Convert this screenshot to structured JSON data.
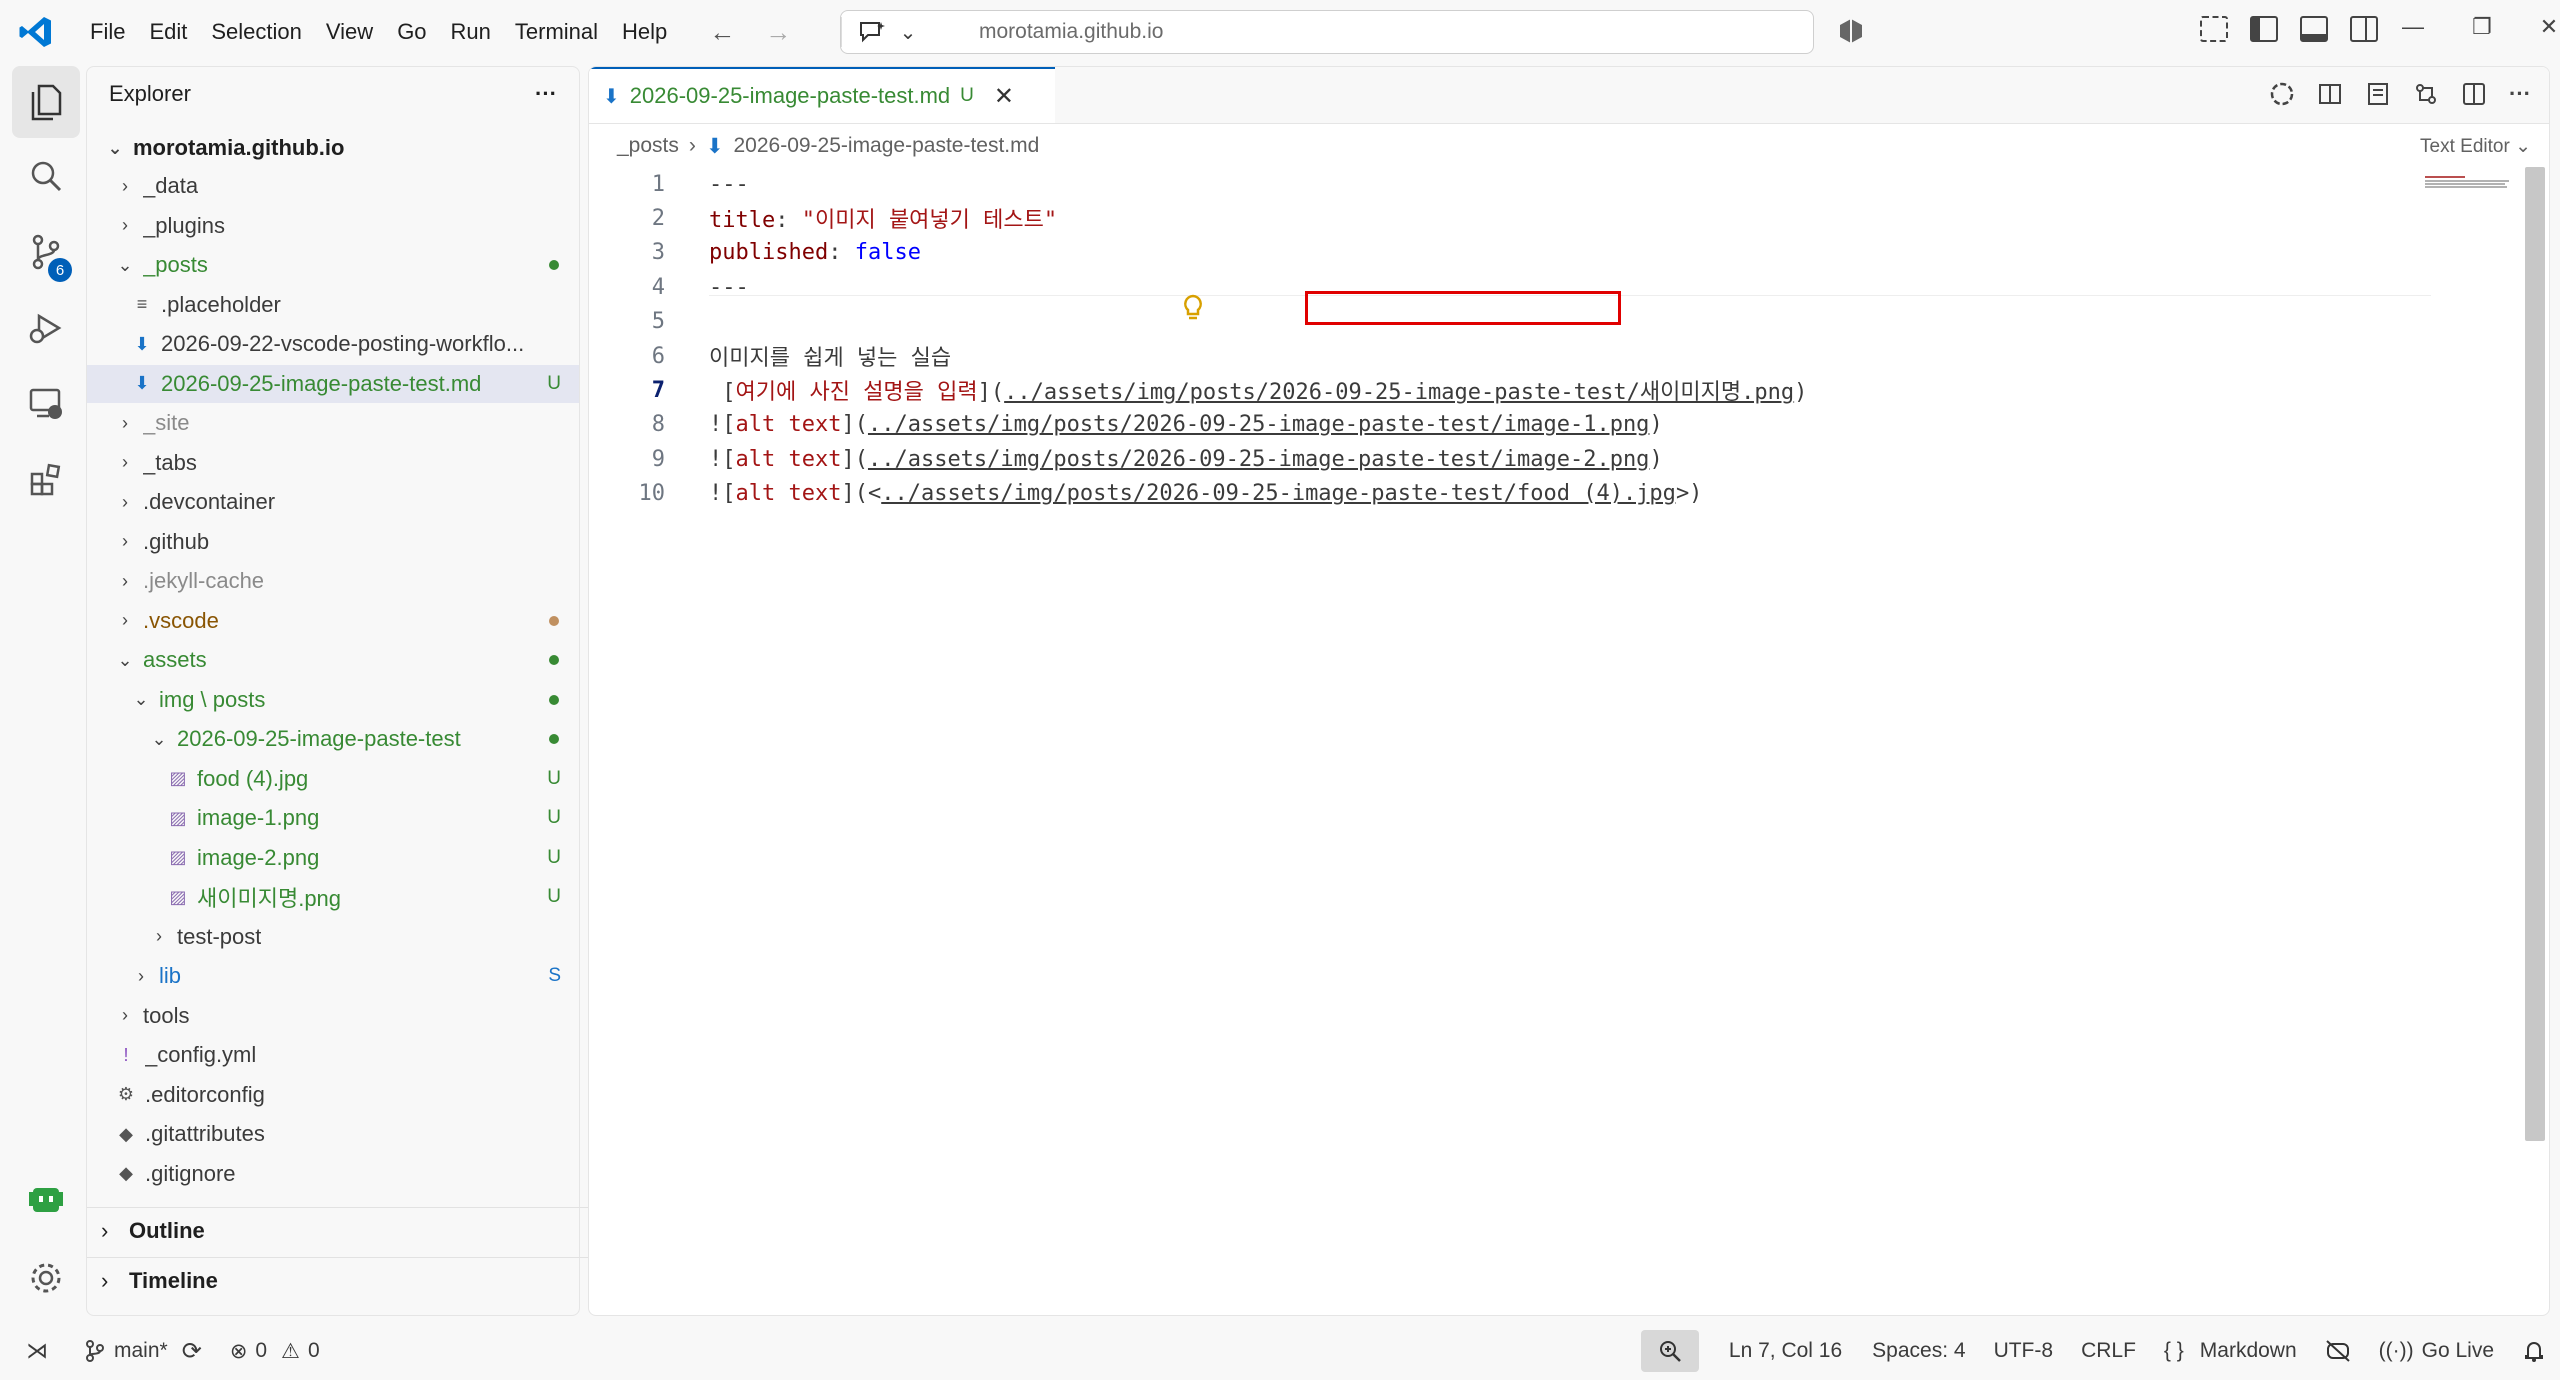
{
  "titlebar": {
    "menu": [
      "File",
      "Edit",
      "Selection",
      "View",
      "Go",
      "Run",
      "Terminal",
      "Help"
    ],
    "search_text": "morotamia.github.io"
  },
  "activity": {
    "source_control_badge": "6"
  },
  "sidebar": {
    "title": "Explorer",
    "more": "···",
    "root": "morotamia.github.io",
    "tree": [
      {
        "label": "_data",
        "chev": "›",
        "indent": 0,
        "color": "#3b3b3b"
      },
      {
        "label": "_plugins",
        "chev": "›",
        "indent": 0,
        "color": "#3b3b3b"
      },
      {
        "label": "_posts",
        "chev": "⌄",
        "indent": 0,
        "color": "#388a34",
        "dot": "#388a34"
      },
      {
        "label": ".placeholder",
        "icon": "≡",
        "indent": 1,
        "color": "#3b3b3b"
      },
      {
        "label": "2026-09-22-vscode-posting-workflo...",
        "icon": "⬇",
        "indent": 1,
        "color": "#3b3b3b"
      },
      {
        "label": "2026-09-25-image-paste-test.md",
        "icon": "⬇",
        "indent": 1,
        "color": "#388a34",
        "status": "U",
        "selected": true
      },
      {
        "label": "_site",
        "chev": "›",
        "indent": 0,
        "color": "#8a8a8a"
      },
      {
        "label": "_tabs",
        "chev": "›",
        "indent": 0,
        "color": "#3b3b3b"
      },
      {
        "label": ".devcontainer",
        "chev": "›",
        "indent": 0,
        "color": "#3b3b3b"
      },
      {
        "label": ".github",
        "chev": "›",
        "indent": 0,
        "color": "#3b3b3b"
      },
      {
        "label": ".jekyll-cache",
        "chev": "›",
        "indent": 0,
        "color": "#8a8a8a"
      },
      {
        "label": ".vscode",
        "chev": "›",
        "indent": 0,
        "color": "#895503",
        "dot": "#c09060"
      },
      {
        "label": "assets",
        "chev": "⌄",
        "indent": 0,
        "color": "#388a34",
        "dot": "#388a34"
      },
      {
        "label": "img \\ posts",
        "chev": "⌄",
        "indent": 1,
        "color": "#388a34",
        "dot": "#388a34"
      },
      {
        "label": "2026-09-25-image-paste-test",
        "chev": "⌄",
        "indent": 2,
        "color": "#388a34",
        "dot": "#388a34"
      },
      {
        "label": "food (4).jpg",
        "icon": "▨",
        "indent": 3,
        "color": "#388a34",
        "status": "U"
      },
      {
        "label": "image-1.png",
        "icon": "▨",
        "indent": 3,
        "color": "#388a34",
        "status": "U"
      },
      {
        "label": "image-2.png",
        "icon": "▨",
        "indent": 3,
        "color": "#388a34",
        "status": "U"
      },
      {
        "label": "새이미지명.png",
        "icon": "▨",
        "indent": 3,
        "color": "#388a34",
        "status": "U"
      },
      {
        "label": "test-post",
        "chev": "›",
        "indent": 2,
        "color": "#3b3b3b"
      },
      {
        "label": "lib",
        "chev": "›",
        "indent": 1,
        "color": "#1a73c7",
        "status": "S",
        "status_color": "#1a73c7"
      },
      {
        "label": "tools",
        "chev": "›",
        "indent": 0,
        "color": "#3b3b3b"
      },
      {
        "label": "_config.yml",
        "icon": "!",
        "indent": 0,
        "color": "#3b3b3b"
      },
      {
        "label": ".editorconfig",
        "icon": "⚙",
        "indent": 0,
        "color": "#3b3b3b"
      },
      {
        "label": ".gitattributes",
        "icon": "◆",
        "indent": 0,
        "color": "#3b3b3b"
      },
      {
        "label": ".gitignore",
        "icon": "◆",
        "indent": 0,
        "color": "#3b3b3b"
      }
    ],
    "outline": "Outline",
    "timeline": "Timeline"
  },
  "editor": {
    "tab_title": "2026-09-25-image-paste-test.md",
    "tab_status": "U",
    "breadcrumb_folder": "_posts",
    "breadcrumb_file": "2026-09-25-image-paste-test.md",
    "text_editor_label": "Text Editor",
    "lines": [
      {
        "n": "1",
        "parts": [
          {
            "t": "---",
            "c": ""
          }
        ]
      },
      {
        "n": "2",
        "parts": [
          {
            "t": "title",
            "c": "key"
          },
          {
            "t": ": ",
            "c": ""
          },
          {
            "t": "\"이미지 붙여넣기 테스트\"",
            "c": "str"
          }
        ]
      },
      {
        "n": "3",
        "parts": [
          {
            "t": "published",
            "c": "key"
          },
          {
            "t": ": ",
            "c": ""
          },
          {
            "t": "false",
            "c": "kw"
          }
        ]
      },
      {
        "n": "4",
        "parts": [
          {
            "t": "---",
            "c": ""
          }
        ]
      },
      {
        "n": "5",
        "parts": []
      },
      {
        "n": "6",
        "parts": [
          {
            "t": "이미지를 쉽게 넣는 실습",
            "c": ""
          }
        ]
      },
      {
        "n": "7",
        "parts": [
          {
            "t": " [",
            "c": ""
          },
          {
            "t": "여기에 사진 설명을 입력",
            "c": "lnk"
          },
          {
            "t": "](",
            "c": ""
          },
          {
            "t": "../assets/img/posts/2026-09-25-image-paste-test/새이미지명.png",
            "c": "url"
          },
          {
            "t": ")",
            "c": ""
          }
        ],
        "current": true
      },
      {
        "n": "8",
        "parts": [
          {
            "t": "![",
            "c": ""
          },
          {
            "t": "alt text",
            "c": "lnk"
          },
          {
            "t": "](",
            "c": ""
          },
          {
            "t": "../assets/img/posts/2026-09-25-image-paste-test/image-1.png",
            "c": "url"
          },
          {
            "t": ")",
            "c": ""
          }
        ]
      },
      {
        "n": "9",
        "parts": [
          {
            "t": "![",
            "c": ""
          },
          {
            "t": "alt text",
            "c": "lnk"
          },
          {
            "t": "](",
            "c": ""
          },
          {
            "t": "../assets/img/posts/2026-09-25-image-paste-test/image-2.png",
            "c": "url"
          },
          {
            "t": ")",
            "c": ""
          }
        ]
      },
      {
        "n": "10",
        "parts": [
          {
            "t": "![",
            "c": ""
          },
          {
            "t": "alt text",
            "c": "lnk"
          },
          {
            "t": "](<",
            "c": ""
          },
          {
            "t": "../assets/img/posts/2026-09-25-image-paste-test/food (4).jpg",
            "c": "url"
          },
          {
            "t": ">)",
            "c": ""
          }
        ]
      }
    ]
  },
  "statusbar": {
    "branch": "main*",
    "errors": "0",
    "warnings": "0",
    "position": "Ln 7, Col 16",
    "spaces": "Spaces: 4",
    "encoding": "UTF-8",
    "eol": "CRLF",
    "language_braces": "{ }",
    "language": "Markdown",
    "golive": "Go Live"
  }
}
